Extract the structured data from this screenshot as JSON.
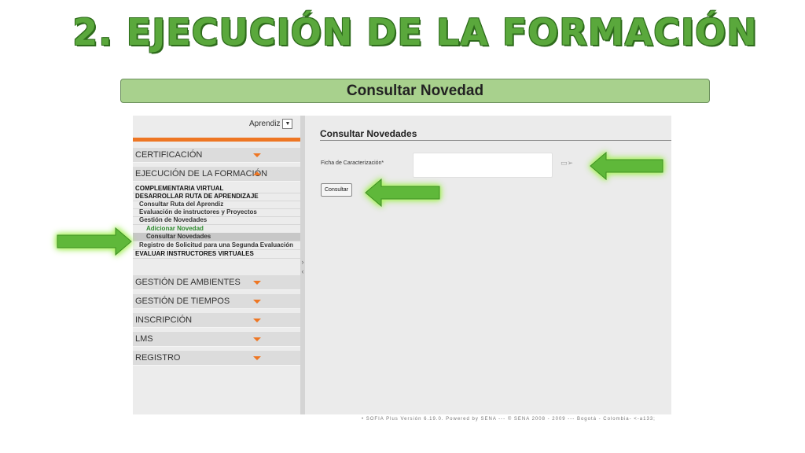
{
  "slide": {
    "title": "2. EJECUCIÓN DE LA FORMACIÓN",
    "banner": "Consultar Novedad"
  },
  "colors": {
    "title_green": "#5aa83c",
    "banner_green": "#a8d18d",
    "accent_orange": "#ee7623",
    "arrow_green": "#5fb83a"
  },
  "app": {
    "role": {
      "selected": "Aprendiz",
      "icon": "chevron-down-icon"
    },
    "menu": {
      "certificacion": "CERTIFICACIÓN",
      "ejecucion": "EJECUCIÓN DE LA FORMACIÓN",
      "sub": {
        "complementaria": "COMPLEMENTARIA VIRTUAL",
        "desarrollar": "DESARROLLAR RUTA DE APRENDIZAJE",
        "consultar_ruta": "Consultar Ruta del Aprendiz",
        "evaluacion": "Evaluación de instructores y Proyectos",
        "gestion_novedades": "Gestión de Novedades",
        "adicionar": "Adicionar Novedad",
        "consultar_novedades": "Consultar Novedades",
        "registro_solicitud": "Registro de Solicitud para una Segunda Evaluación",
        "evaluar": "EVALUAR INSTRUCTORES VIRTUALES"
      },
      "ambientes": "GESTIÓN DE AMBIENTES",
      "tiempos": "GESTIÓN DE TIEMPOS",
      "inscripcion": "INSCRIPCIÓN",
      "lms": "LMS",
      "registro": "REGISTRO"
    },
    "content": {
      "title": "Consultar Novedades",
      "field_label": "Ficha de Caracterización*",
      "field_value": "",
      "lookup_icon": "lookup-icon",
      "button": "Consultar"
    },
    "footer": "• SOFIA Plus Versión 6.19.0. Powered by SENA --- © SENA 2008 - 2009 --- Bogotá - Colombia- <-a133;"
  }
}
